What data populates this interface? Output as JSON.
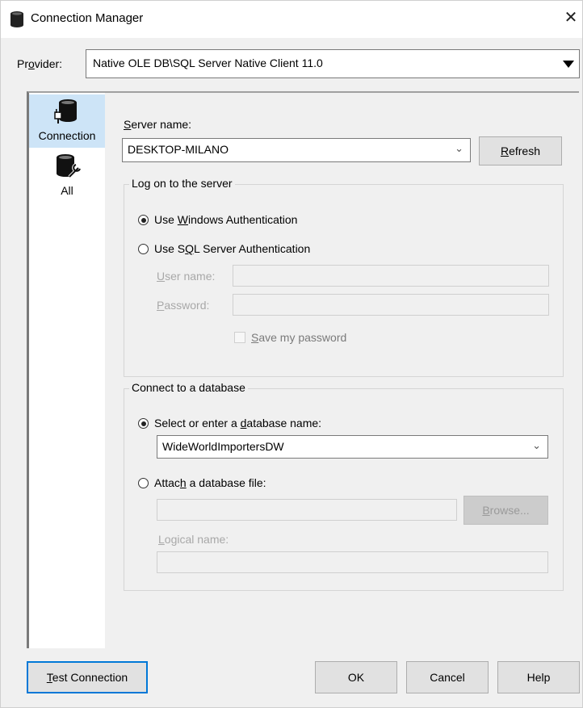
{
  "window": {
    "title": "Connection Manager",
    "close_glyph": "✕"
  },
  "provider": {
    "label_prefix": "Pr",
    "label_ul": "o",
    "label_suffix": "vider:",
    "value": "Native OLE DB\\SQL Server Native Client 11.0"
  },
  "sidebar": {
    "items": [
      {
        "label": "Connection",
        "icon": "database-plug-icon"
      },
      {
        "label": "All",
        "icon": "database-wrench-icon"
      }
    ]
  },
  "server": {
    "label_ul": "S",
    "label_rest": "erver name:",
    "value": "DESKTOP-MILANO",
    "refresh_ul": "R",
    "refresh_rest": "efresh"
  },
  "logon": {
    "group_title": "Log on to the server",
    "windows_auth": {
      "pre": "Use ",
      "ul": "W",
      "post": "indows Authentication"
    },
    "sql_auth": {
      "pre": "Use S",
      "ul": "Q",
      "post": "L Server Authentication"
    },
    "username": {
      "ul": "U",
      "rest": "ser name:"
    },
    "password": {
      "ul": "P",
      "rest": "assword:"
    },
    "save_password": {
      "ul": "S",
      "rest": "ave my password"
    }
  },
  "database": {
    "group_title": "Connect to a database",
    "select_option": {
      "pre": "Select or enter a ",
      "ul": "d",
      "post": "atabase name:"
    },
    "db_value": "WideWorldImportersDW",
    "attach_option": {
      "pre": "Attac",
      "ul": "h",
      "post": " a database file:"
    },
    "browse": {
      "ul": "B",
      "rest": "rowse..."
    },
    "logical_name": {
      "ul": "L",
      "rest": "ogical name:"
    }
  },
  "footer": {
    "test_connection": {
      "ul": "T",
      "rest": "est Connection"
    },
    "ok": "OK",
    "cancel": "Cancel",
    "help": "Help"
  },
  "colors": {
    "selection": "#cde4f7",
    "default_border": "#0078d7",
    "dialog_bg": "#f0f0f0"
  }
}
